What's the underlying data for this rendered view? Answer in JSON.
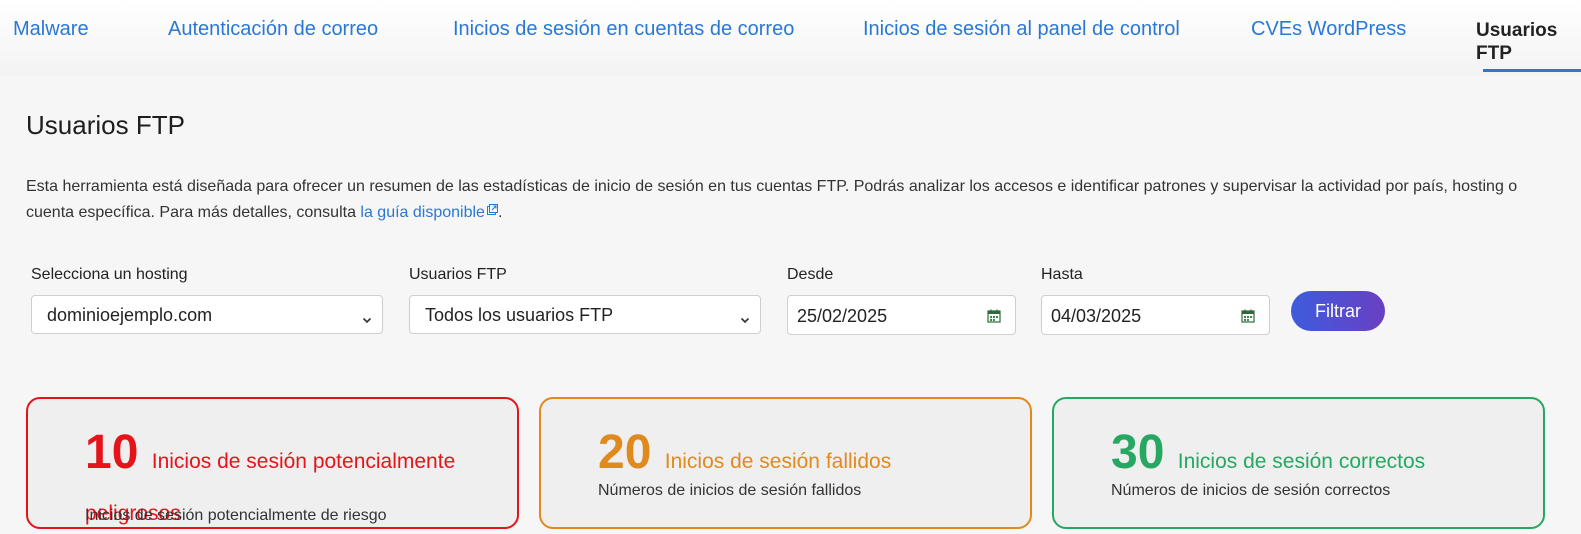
{
  "tabs": [
    {
      "label": "Malware"
    },
    {
      "label": "Autenticación de correo"
    },
    {
      "label": "Inicios de sesión en cuentas de correo"
    },
    {
      "label": "Inicios de sesión al panel de control"
    },
    {
      "label": "CVEs WordPress"
    },
    {
      "label": "Usuarios FTP",
      "active": true
    }
  ],
  "page": {
    "title": "Usuarios FTP",
    "intro_text": "Esta herramienta está diseñada para ofrecer un resumen de las estadísticas de inicio de sesión en tus cuentas FTP. Podrás analizar los accesos e identificar patrones y supervisar la actividad por país, hosting o cuenta específica. Para más detalles, consulta ",
    "guide_link": "la guía disponible",
    "intro_end": "."
  },
  "filters": {
    "hosting": {
      "label": "Selecciona un hosting",
      "value": "dominioejemplo.com"
    },
    "ftp_users": {
      "label": "Usuarios FTP",
      "value": "Todos los usuarios FTP"
    },
    "from": {
      "label": "Desde",
      "value": "25/02/2025"
    },
    "to": {
      "label": "Hasta",
      "value": "04/03/2025"
    },
    "submit_label": "Filtrar"
  },
  "cards": [
    {
      "count": "10",
      "title": "Inicios de sesión potencialmente peligrosos",
      "subtitle": "Inicios de sesión potencialmente de riesgo",
      "color": "#e5141b"
    },
    {
      "count": "20",
      "title": "Inicios de sesión fallidos",
      "subtitle": "Números de inicios de sesión fallidos",
      "color": "#e08a1e"
    },
    {
      "count": "30",
      "title": "Inicios de sesión correctos",
      "subtitle": "Números de inicios de sesión correctos",
      "color": "#27a862"
    }
  ],
  "icons": {
    "external_link": "external-link-icon",
    "dropdown": "chevron-down-icon",
    "calendar": "calendar-icon"
  },
  "colors": {
    "link": "#2a78d6",
    "accent_start": "#3d5cdc",
    "accent_end": "#6a3fc4"
  }
}
